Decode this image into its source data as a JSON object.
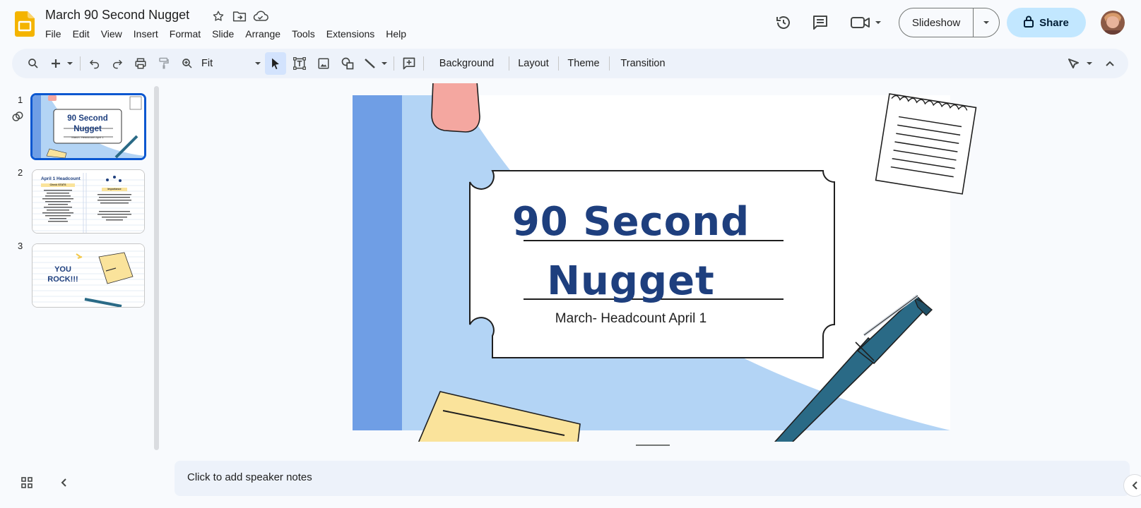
{
  "app": {
    "title": "March 90 Second Nugget",
    "menu": [
      "File",
      "Edit",
      "View",
      "Insert",
      "Format",
      "Slide",
      "Arrange",
      "Tools",
      "Extensions",
      "Help"
    ]
  },
  "header": {
    "slideshow_label": "Slideshow",
    "share_label": "Share"
  },
  "toolbar": {
    "zoom_value": "Fit",
    "background_label": "Background",
    "layout_label": "Layout",
    "theme_label": "Theme",
    "transition_label": "Transition"
  },
  "filmstrip": {
    "slides": [
      {
        "number": "1",
        "title_line1": "90 Second",
        "title_line2": "Nugget",
        "subtitle": "March- Headcount April 1"
      },
      {
        "number": "2",
        "heading": "April 1 Headcount",
        "col1_heading": "Check STATS",
        "col2_heading": "Importance"
      },
      {
        "number": "3",
        "text_line1": "YOU",
        "text_line2": "ROCK!!!"
      }
    ]
  },
  "slide": {
    "title_line1": "90 Second",
    "title_line2": "Nugget",
    "subtitle": "March- Headcount April 1"
  },
  "notes": {
    "placeholder": "Click to add speaker notes"
  },
  "colors": {
    "accent_blue": "#0b57d0",
    "share_bg": "#c2e7ff",
    "slide_title": "#1e3f7e",
    "slide_band": "#6f9ee5",
    "slide_wave": "#b3d4f5",
    "sticky_yellow": "#fae39b",
    "pen_teal": "#2a6a86"
  }
}
